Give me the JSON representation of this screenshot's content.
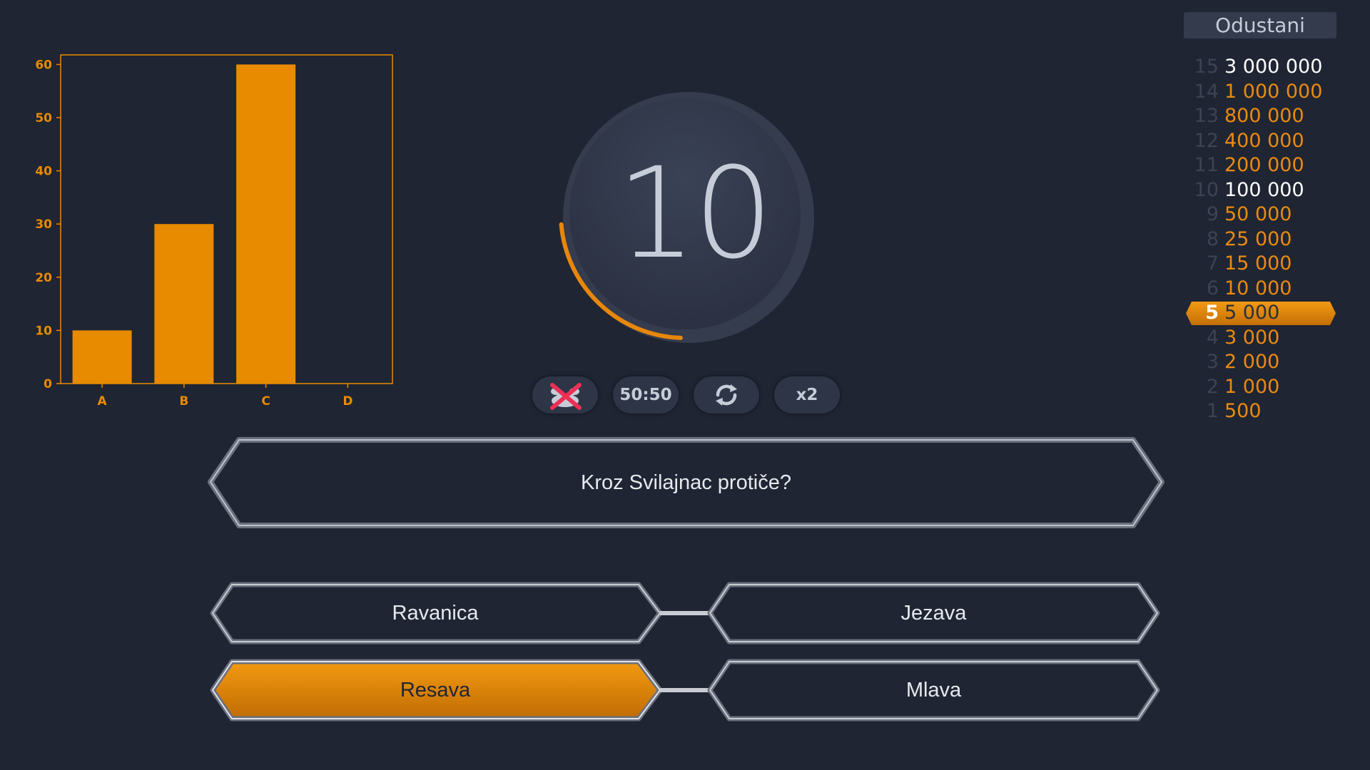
{
  "chart_data": {
    "type": "bar",
    "categories": [
      "A",
      "B",
      "C",
      "D"
    ],
    "values": [
      10,
      30,
      60,
      0
    ],
    "ylim": [
      0,
      60
    ],
    "yticks": [
      0,
      10,
      20,
      30,
      40,
      50,
      60
    ],
    "color": "#e88b00",
    "grid": false
  },
  "timer": {
    "value": "10",
    "remaining_fraction": 0.35
  },
  "lifelines": [
    {
      "id": "phone",
      "icon": "phone-friend-icon",
      "used": true
    },
    {
      "id": "fifty",
      "label": "50:50",
      "used": false
    },
    {
      "id": "switch",
      "icon": "switch-question-icon",
      "used": false
    },
    {
      "id": "double",
      "label": "x2",
      "used": false
    }
  ],
  "question": {
    "text": "Kroz Svilajnac protiče?"
  },
  "answers": [
    {
      "text": "Ravanica",
      "selected": false
    },
    {
      "text": "Jezava",
      "selected": false
    },
    {
      "text": "Resava",
      "selected": true
    },
    {
      "text": "Mlava",
      "selected": false
    }
  ],
  "quit_label": "Odustani",
  "ladder": [
    {
      "level": "15",
      "amount": "3 000 000",
      "safe": true
    },
    {
      "level": "14",
      "amount": "1 000 000"
    },
    {
      "level": "13",
      "amount": "800 000"
    },
    {
      "level": "12",
      "amount": "400 000"
    },
    {
      "level": "11",
      "amount": "200 000"
    },
    {
      "level": "10",
      "amount": "100 000",
      "safe": true
    },
    {
      "level": "9",
      "amount": "50 000"
    },
    {
      "level": "8",
      "amount": "25 000"
    },
    {
      "level": "7",
      "amount": "15 000"
    },
    {
      "level": "6",
      "amount": "10 000"
    },
    {
      "level": "5",
      "amount": "5 000",
      "current": true
    },
    {
      "level": "4",
      "amount": "3 000"
    },
    {
      "level": "3",
      "amount": "2 000"
    },
    {
      "level": "2",
      "amount": "1 000"
    },
    {
      "level": "1",
      "amount": "500"
    }
  ],
  "colors": {
    "background": "#1f2533",
    "accent": "#e88b00",
    "text": "#e6e9ee"
  }
}
